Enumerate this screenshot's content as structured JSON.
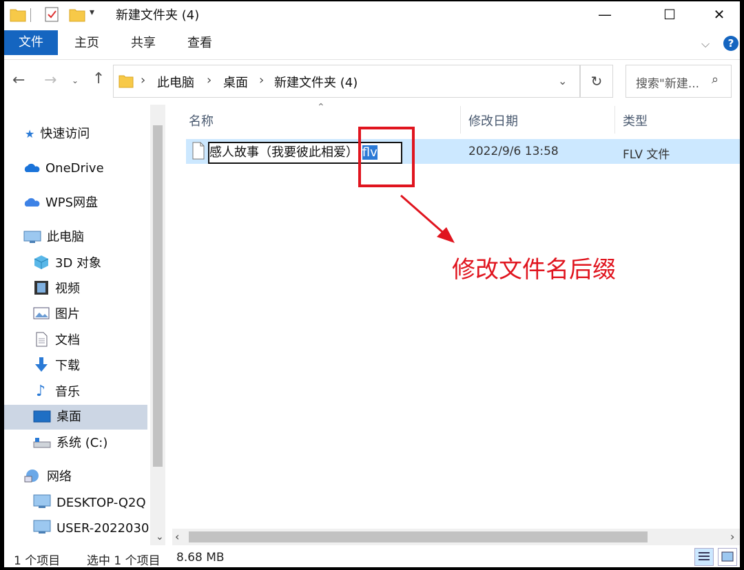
{
  "window": {
    "title": "新建文件夹 (4)",
    "minimize": "—",
    "maximize": "☐",
    "close": "✕",
    "help": "?"
  },
  "ribbon": {
    "tabs": [
      "文件",
      "主页",
      "共享",
      "查看"
    ]
  },
  "address": {
    "breadcrumb": [
      "此电脑",
      "桌面",
      "新建文件夹 (4)"
    ],
    "search_placeholder": "搜索\"新建...",
    "refresh": "↻"
  },
  "sidebar": {
    "items": [
      {
        "label": "快速访问",
        "icon": "star-icon"
      },
      {
        "label": "OneDrive",
        "icon": "cloud-icon"
      },
      {
        "label": "WPS网盘",
        "icon": "wps-cloud-icon"
      },
      {
        "label": "此电脑",
        "icon": "computer-icon"
      },
      {
        "label": "3D 对象",
        "icon": "cube-icon"
      },
      {
        "label": "视频",
        "icon": "video-icon"
      },
      {
        "label": "图片",
        "icon": "pictures-icon"
      },
      {
        "label": "文档",
        "icon": "document-icon"
      },
      {
        "label": "下载",
        "icon": "download-icon"
      },
      {
        "label": "音乐",
        "icon": "music-icon"
      },
      {
        "label": "桌面",
        "icon": "desktop-icon"
      },
      {
        "label": "系统 (C:)",
        "icon": "drive-icon"
      },
      {
        "label": "网络",
        "icon": "network-icon"
      },
      {
        "label": "DESKTOP-Q2Q",
        "icon": "monitor-icon"
      },
      {
        "label": "USER-2022030",
        "icon": "monitor-icon"
      }
    ]
  },
  "columns": {
    "name": "名称",
    "modified": "修改日期",
    "type": "类型"
  },
  "files": [
    {
      "name_base": "感人故事（我要彼此相爱）",
      "name_dot": ".",
      "name_ext": "flv",
      "modified": "2022/9/6 13:58",
      "type": "FLV 文件"
    }
  ],
  "annotation": {
    "text": "修改文件名后缀",
    "color": "#e0141e"
  },
  "status": {
    "count": "1 个项目",
    "selected": "选中 1 个项目",
    "size": "8.68 MB"
  },
  "colors": {
    "accent": "#1565c0",
    "selection": "#cce8ff",
    "highlight": "#e0141e"
  }
}
